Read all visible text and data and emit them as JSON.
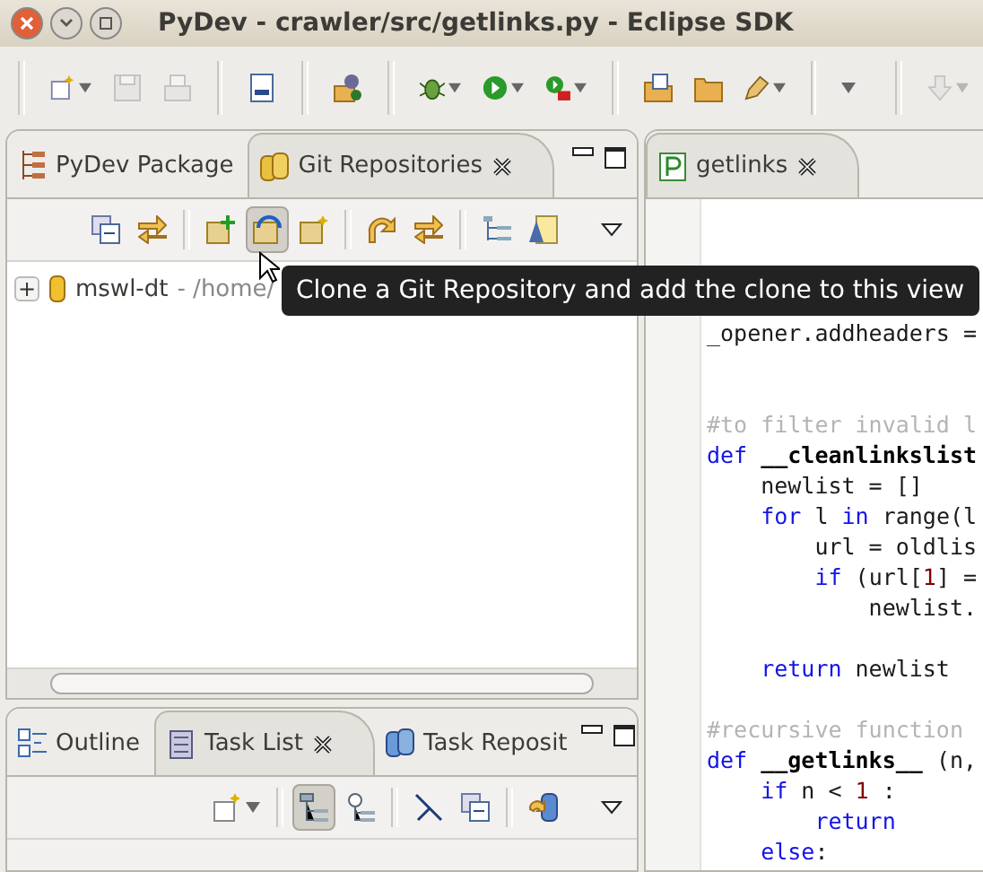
{
  "window": {
    "title": "PyDev - crawler/src/getlinks.py - Eclipse SDK"
  },
  "toolbar": [
    {
      "kind": "separator"
    },
    {
      "kind": "new",
      "dropdown": true,
      "disabled": false
    },
    {
      "kind": "save",
      "dropdown": false,
      "disabled": true
    },
    {
      "kind": "print",
      "dropdown": false,
      "disabled": true
    },
    {
      "kind": "separator"
    },
    {
      "kind": "binary",
      "dropdown": false,
      "disabled": false
    },
    {
      "kind": "separator"
    },
    {
      "kind": "package",
      "dropdown": false,
      "disabled": false
    },
    {
      "kind": "separator"
    },
    {
      "kind": "debug",
      "dropdown": true,
      "disabled": false
    },
    {
      "kind": "run",
      "dropdown": true,
      "disabled": false
    },
    {
      "kind": "external",
      "dropdown": true,
      "disabled": false
    },
    {
      "kind": "separator"
    },
    {
      "kind": "open-type",
      "dropdown": false,
      "disabled": false
    },
    {
      "kind": "folder",
      "dropdown": false,
      "disabled": false
    },
    {
      "kind": "pen",
      "dropdown": true,
      "disabled": false
    },
    {
      "kind": "separator"
    },
    {
      "kind": "menu-only",
      "dropdown": true,
      "disabled": false
    },
    {
      "kind": "separator"
    },
    {
      "kind": "import",
      "dropdown": true,
      "disabled": true
    }
  ],
  "left_view": {
    "tabs": [
      {
        "label": "PyDev Package",
        "kind": "package-tree",
        "selected": false
      },
      {
        "label": "Git Repositories",
        "kind": "git-repos",
        "selected": true
      }
    ],
    "toolbar": [
      {
        "kind": "collapse",
        "pressed": false
      },
      {
        "kind": "link",
        "pressed": false
      },
      {
        "kind": "separator"
      },
      {
        "kind": "git-add",
        "pressed": false
      },
      {
        "kind": "git-clone",
        "pressed": true
      },
      {
        "kind": "git-create",
        "pressed": false
      },
      {
        "kind": "separator"
      },
      {
        "kind": "refresh",
        "pressed": false
      },
      {
        "kind": "link",
        "pressed": false
      },
      {
        "kind": "separator"
      },
      {
        "kind": "tree",
        "pressed": false
      },
      {
        "kind": "note",
        "pressed": false
      }
    ],
    "tree": [
      {
        "toggle": "+",
        "name": "mswl-dt",
        "detail": "- /home/"
      }
    ]
  },
  "tooltip": "Clone a Git Repository and add the clone to this view",
  "bottom_view": {
    "tabs": [
      {
        "label": "Outline",
        "kind": "outline",
        "selected": false
      },
      {
        "label": "Task List",
        "kind": "task-list",
        "selected": true
      },
      {
        "label": "Task Reposit",
        "kind": "task-repos",
        "selected": false
      }
    ],
    "toolbar": [
      {
        "kind": "task-new",
        "pressed": false,
        "dropdown": true
      },
      {
        "kind": "separator"
      },
      {
        "kind": "categorized",
        "pressed": true
      },
      {
        "kind": "scheduled",
        "pressed": false
      },
      {
        "kind": "separator"
      },
      {
        "kind": "complete",
        "pressed": false
      },
      {
        "kind": "collapse",
        "pressed": false
      },
      {
        "kind": "separator"
      },
      {
        "kind": "sync",
        "pressed": false
      }
    ]
  },
  "editor": {
    "tabs": [
      {
        "label": "getlinks",
        "kind": "python-file",
        "selected": true
      }
    ],
    "lines": [
      {
        "kind": "covered"
      },
      {
        "kind": "covered"
      },
      {
        "kind": "code",
        "segments": [
          {
            "t": "_opener.addheaders =",
            "kind": "plain"
          }
        ]
      },
      {
        "kind": "blank"
      },
      {
        "kind": "blank"
      },
      {
        "kind": "code",
        "segments": [
          {
            "t": "#to filter invalid l",
            "kind": "comment"
          }
        ]
      },
      {
        "kind": "code",
        "segments": [
          {
            "t": "def",
            "kind": "keyword"
          },
          {
            "t": " __cleanlinkslist",
            "kind": "name"
          }
        ],
        "children": [
          {
            "kind": "code",
            "segments": [
              {
                "t": "newlist = []",
                "kind": "plain"
              }
            ]
          },
          {
            "kind": "code",
            "segments": [
              {
                "t": "for",
                "kind": "keyword"
              },
              {
                "t": " l ",
                "kind": "plain"
              },
              {
                "t": "in",
                "kind": "keyword"
              },
              {
                "t": " range(l",
                "kind": "plain"
              }
            ],
            "children": [
              {
                "kind": "code",
                "segments": [
                  {
                    "t": "url = oldlis",
                    "kind": "plain"
                  }
                ]
              },
              {
                "kind": "code",
                "segments": [
                  {
                    "t": "if",
                    "kind": "keyword"
                  },
                  {
                    "t": " (url[",
                    "kind": "plain"
                  },
                  {
                    "t": "1",
                    "kind": "number"
                  },
                  {
                    "t": "] =",
                    "kind": "plain"
                  }
                ],
                "children": [
                  {
                    "kind": "code",
                    "segments": [
                      {
                        "t": "newlist.",
                        "kind": "plain"
                      }
                    ]
                  }
                ]
              }
            ]
          },
          {
            "kind": "blank"
          },
          {
            "kind": "code",
            "segments": [
              {
                "t": "return",
                "kind": "keyword"
              },
              {
                "t": " newlist",
                "kind": "plain"
              }
            ]
          }
        ]
      },
      {
        "kind": "blank"
      },
      {
        "kind": "code",
        "segments": [
          {
            "t": "#recursive function",
            "kind": "comment"
          }
        ]
      },
      {
        "kind": "code",
        "segments": [
          {
            "t": "def",
            "kind": "keyword"
          },
          {
            "t": " __getlinks__",
            "kind": "name"
          },
          {
            "t": " (n,",
            "kind": "plain"
          }
        ],
        "children": [
          {
            "kind": "code",
            "segments": [
              {
                "t": "if",
                "kind": "keyword"
              },
              {
                "t": " n < ",
                "kind": "plain"
              },
              {
                "t": "1",
                "kind": "number"
              },
              {
                "t": " :",
                "kind": "plain"
              }
            ],
            "children": [
              {
                "kind": "code",
                "segments": [
                  {
                    "t": "return",
                    "kind": "keyword"
                  }
                ]
              }
            ]
          },
          {
            "kind": "code",
            "segments": [
              {
                "t": "else",
                "kind": "keyword"
              },
              {
                "t": ":",
                "kind": "plain"
              }
            ]
          }
        ]
      }
    ]
  }
}
